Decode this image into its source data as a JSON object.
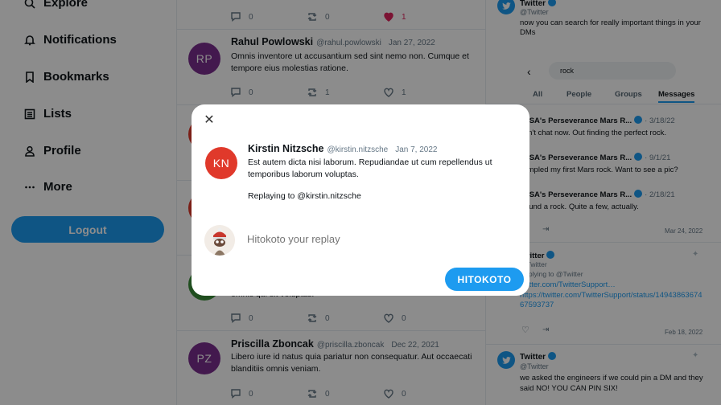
{
  "sidebar": {
    "items": [
      {
        "label": "Explore",
        "icon": "search-icon"
      },
      {
        "label": "Notifications",
        "icon": "bell-icon"
      },
      {
        "label": "Bookmarks",
        "icon": "bookmark-icon"
      },
      {
        "label": "Lists",
        "icon": "list-icon"
      },
      {
        "label": "Profile",
        "icon": "person-icon"
      },
      {
        "label": "More",
        "icon": "more-icon"
      }
    ],
    "logout": "Logout"
  },
  "feed": {
    "top_actions": {
      "replies": "0",
      "retweets": "0",
      "likes": "1"
    },
    "tweets": [
      {
        "initials": "RP",
        "color": "#7b2f8e",
        "name": "Rahul Powlowski",
        "handle": "@rahul.powlowski",
        "date": "Jan 27, 2022",
        "body": "Omnis inventore ut accusantium sed sint nemo non. Cumque et tempore eius molestias ratione.",
        "replies": "0",
        "retweets": "1",
        "likes": "1"
      },
      {
        "initials": "",
        "color": "#3b8f3a",
        "name": "",
        "handle": "",
        "date": "",
        "body": "omnis qui sit voluptas.",
        "replies": "0",
        "retweets": "0",
        "likes": "0"
      },
      {
        "initials": "PZ",
        "color": "#7b2f8e",
        "name": "Priscilla Zboncak",
        "handle": "@priscilla.zboncak",
        "date": "Dec 22, 2021",
        "body": "Libero iure id natus quia pariatur non consequatur. Aut occaecati blanditiis omnis veniam.",
        "replies": "0",
        "retweets": "0",
        "likes": "0"
      }
    ]
  },
  "right": {
    "top_dm": {
      "name": "Twitter",
      "handle": "@Twitter",
      "text": "now you can search for really important things in your DMs"
    },
    "search_value": "rock",
    "tabs": [
      "All",
      "People",
      "Groups",
      "Messages"
    ],
    "results": [
      {
        "name": "NASA's Perseverance Mars R...",
        "date": "3/18/22",
        "text": "Can't chat now. Out finding the perfect rock."
      },
      {
        "name": "NASA's Perseverance Mars R...",
        "date": "9/1/21",
        "text": "Sampled my first Mars rock. Want to see a pic?"
      },
      {
        "name": "NASA's Perseverance Mars R...",
        "date": "2/18/21",
        "text": "I found a rock. Quite a few, actually."
      }
    ],
    "date1": "Mar 24, 2022",
    "tw2": {
      "name": "Twitter",
      "handle": "@Twitter",
      "reply": "Replying to @Twitter",
      "link1": "twitter.com/TwitterSupport…",
      "link2": "https://twitter.com/TwitterSupport/status/1494386367467593737",
      "date": "Feb 18, 2022"
    },
    "tw3": {
      "name": "Twitter",
      "handle": "@Twitter",
      "text": "we asked the engineers if we could pin a DM and they said NO! YOU CAN PIN SIX!"
    }
  },
  "modal": {
    "initials": "KN",
    "avatar_color": "#e0392b",
    "name": "Kirstin Nitzsche",
    "handle": "@kirstin.nitzsche",
    "date": "Jan 7, 2022",
    "body": "Est autem dicta nisi laborum. Repudiandae ut cum repellendus ut temporibus laborum voluptas.",
    "replying": "Replaying to @kirstin.nitzsche",
    "placeholder": "Hitokoto your replay",
    "button": "HITOKOTO"
  }
}
